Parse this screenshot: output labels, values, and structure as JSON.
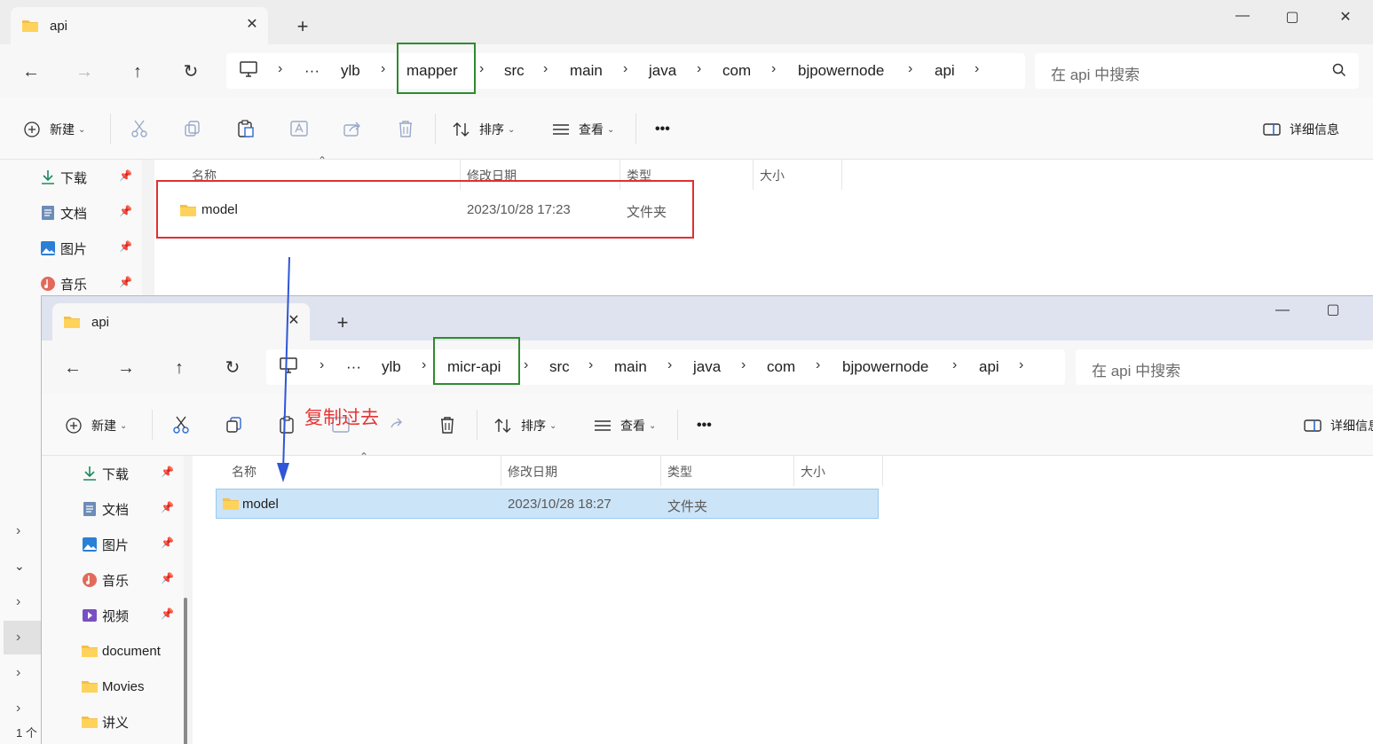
{
  "back_window": {
    "tab": {
      "title": "api"
    },
    "breadcrumbs": [
      "ylb",
      "mapper",
      "src",
      "main",
      "java",
      "com",
      "bjpowernode",
      "api"
    ],
    "search_placeholder": "在 api 中搜索",
    "toolbar": {
      "new_label": "新建",
      "sort_label": "排序",
      "view_label": "查看",
      "more_label": "•••",
      "details_label": "详细信息"
    },
    "sidebar": [
      {
        "label": "下载",
        "icon": "download-icon",
        "pinned": true
      },
      {
        "label": "文档",
        "icon": "documents-icon",
        "pinned": true
      },
      {
        "label": "图片",
        "icon": "pictures-icon",
        "pinned": true
      },
      {
        "label": "音乐",
        "icon": "music-icon",
        "pinned": true
      }
    ],
    "columns": [
      "名称",
      "修改日期",
      "类型",
      "大小"
    ],
    "rows": [
      {
        "name": "model",
        "modified": "2023/10/28 17:23",
        "type": "文件夹"
      }
    ]
  },
  "front_window": {
    "tab": {
      "title": "api"
    },
    "breadcrumbs": [
      "ylb",
      "micr-api",
      "src",
      "main",
      "java",
      "com",
      "bjpowernode",
      "api"
    ],
    "search_placeholder": "在 api 中搜索",
    "toolbar": {
      "new_label": "新建",
      "sort_label": "排序",
      "view_label": "查看",
      "more_label": "•••",
      "details_label": "详细信息"
    },
    "sidebar": [
      {
        "label": "下载",
        "icon": "download-icon",
        "pinned": true
      },
      {
        "label": "文档",
        "icon": "documents-icon",
        "pinned": true
      },
      {
        "label": "图片",
        "icon": "pictures-icon",
        "pinned": true
      },
      {
        "label": "音乐",
        "icon": "music-icon",
        "pinned": true
      },
      {
        "label": "视频",
        "icon": "videos-icon",
        "pinned": true
      },
      {
        "label": "document",
        "icon": "folder-icon",
        "pinned": false
      },
      {
        "label": "Movies",
        "icon": "folder-icon",
        "pinned": false
      },
      {
        "label": "讲义",
        "icon": "folder-icon",
        "pinned": false
      }
    ],
    "columns": [
      "名称",
      "修改日期",
      "类型",
      "大小"
    ],
    "rows": [
      {
        "name": "model",
        "modified": "2023/10/28 18:27",
        "type": "文件夹",
        "selected": true
      }
    ]
  },
  "annotation": {
    "text": "复制过去",
    "arrow_color": "#2f56d6",
    "text_color": "#e53535",
    "box_green": "#2e8b2e",
    "box_red": "#e03030"
  },
  "status_bar": {
    "item_count": "1 个"
  }
}
